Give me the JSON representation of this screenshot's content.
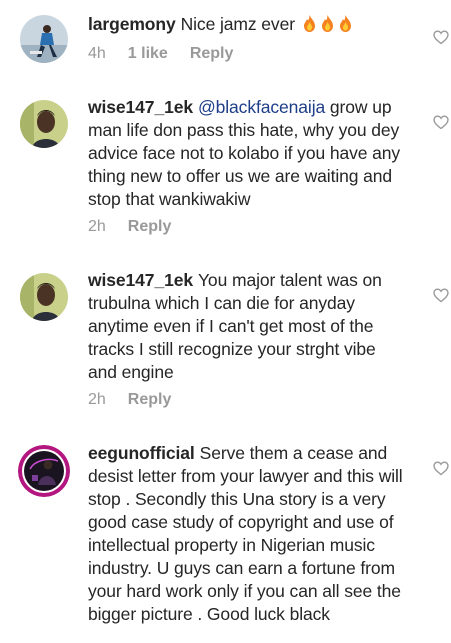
{
  "comments": [
    {
      "username": "largemony",
      "text": "Nice jamz ever",
      "emoji": [
        "fire-icon",
        "fire-icon",
        "fire-icon"
      ],
      "time": "4h",
      "likes": "1 like",
      "reply": "Reply"
    },
    {
      "username": "wise147_1ek",
      "mention": "@blackfacenaija",
      "text": " grow up man life don pass this hate, why you dey advice face not to kolabo if you have any thing new to offer us we are waiting and stop that wankiwakiw",
      "time": "2h",
      "reply": "Reply"
    },
    {
      "username": "wise147_1ek",
      "text": "You major talent was on trubulna which I can die for anyday anytime even if I can't get most of the tracks I still recognize your strght vibe and engine",
      "time": "2h",
      "reply": "Reply"
    },
    {
      "username": "eegunofficial",
      "text": "Serve them a cease and desist letter from your lawyer and this will stop . Secondly this Una story is a very good case study of  copyright and use of intellectual property in Nigerian music industry. U guys can earn a fortune from your hard work only if you can all see the bigger picture . Good luck black"
    }
  ],
  "colors": {
    "username": "#262626",
    "mention": "#1e3e88",
    "meta": "#999999",
    "heart": "#9a9a9a"
  }
}
